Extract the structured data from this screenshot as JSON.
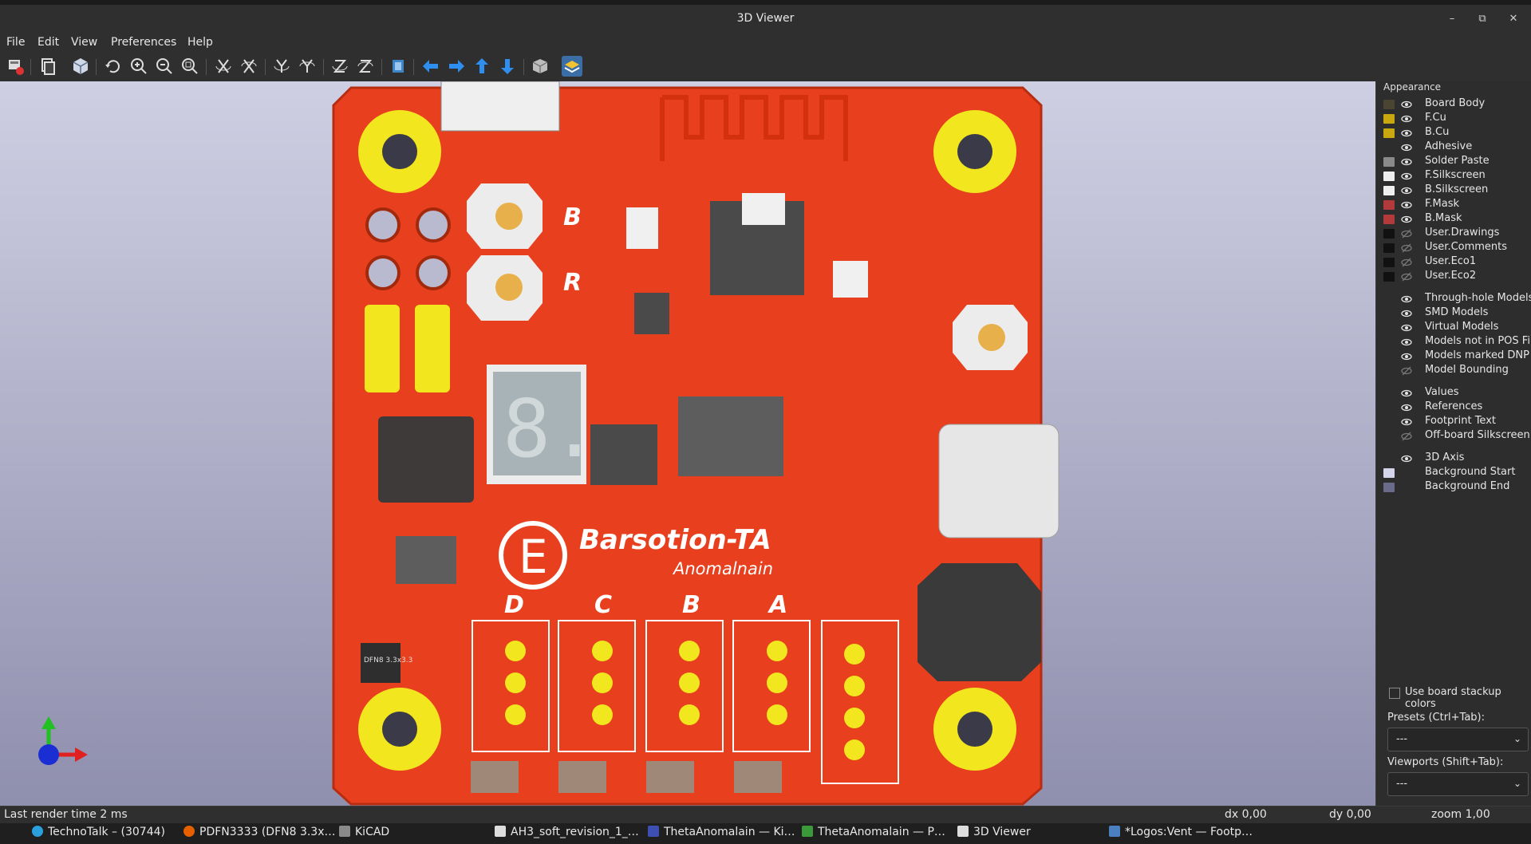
{
  "window": {
    "title": "3D Viewer"
  },
  "window_controls": {
    "minimize_glyph": "–",
    "restore_glyph": "⧉",
    "close_glyph": "✕"
  },
  "menu": {
    "items": [
      "File",
      "Edit",
      "View",
      "Preferences",
      "Help"
    ]
  },
  "toolbar": {
    "icons": [
      "export-image-icon",
      "copy-image-icon",
      "raytracing-icon",
      "reload-icon",
      "zoom-in-icon",
      "zoom-out-icon",
      "zoom-fit-icon",
      "rotate-x-cw-icon",
      "rotate-x-ccw-icon",
      "rotate-y-cw-icon",
      "rotate-y-ccw-icon",
      "rotate-z-cw-icon",
      "rotate-z-ccw-icon",
      "flip-board-icon",
      "move-left-icon",
      "move-right-icon",
      "move-up-icon",
      "move-down-icon",
      "orthographic-icon",
      "layers-manager-icon"
    ]
  },
  "board": {
    "brand_text": "Barsotion-TA",
    "sub_text": "Anomalnain",
    "logo_letter": "E",
    "button_labels": [
      "B",
      "R"
    ],
    "connector_labels": [
      "D",
      "C",
      "B",
      "A"
    ],
    "ic_marking": "DFN8 3.3x3.3",
    "digit_glyph": "8."
  },
  "appearance": {
    "title": "Appearance",
    "layers": [
      {
        "name": "Board Body",
        "color": "#4a4433",
        "visible": true
      },
      {
        "name": "F.Cu",
        "color": "#c9a70f",
        "visible": true
      },
      {
        "name": "B.Cu",
        "color": "#c9a70f",
        "visible": true
      },
      {
        "name": "Adhesive",
        "color": "",
        "visible": true
      },
      {
        "name": "Solder Paste",
        "color": "#8a8a8a",
        "visible": true
      },
      {
        "name": "F.Silkscreen",
        "color": "#eeeeee",
        "visible": true
      },
      {
        "name": "B.Silkscreen",
        "color": "#eeeeee",
        "visible": true
      },
      {
        "name": "F.Mask",
        "color": "#b33a3a",
        "visible": true
      },
      {
        "name": "B.Mask",
        "color": "#b33a3a",
        "visible": true
      },
      {
        "name": "User.Drawings",
        "color": "#111111",
        "visible": false
      },
      {
        "name": "User.Comments",
        "color": "#111111",
        "visible": false
      },
      {
        "name": "User.Eco1",
        "color": "#111111",
        "visible": false
      },
      {
        "name": "User.Eco2",
        "color": "#111111",
        "visible": false
      }
    ],
    "objects": [
      {
        "name": "Through-hole Models",
        "visible": true
      },
      {
        "name": "SMD Models",
        "visible": true
      },
      {
        "name": "Virtual Models",
        "visible": true
      },
      {
        "name": "Models not in POS File",
        "visible": true
      },
      {
        "name": "Models marked DNP",
        "visible": true
      },
      {
        "name": "Model Bounding",
        "visible": false
      }
    ],
    "text_items": [
      {
        "name": "Values",
        "visible": true
      },
      {
        "name": "References",
        "visible": true
      },
      {
        "name": "Footprint Text",
        "visible": true
      },
      {
        "name": "Off-board Silkscreen",
        "visible": false
      }
    ],
    "misc": [
      {
        "name": "3D Axis",
        "color": "",
        "visible": true
      },
      {
        "name": "Background Start",
        "color": "#d4d4ea",
        "visible": null
      },
      {
        "name": "Background End",
        "color": "#6a6a8a",
        "visible": null
      }
    ],
    "use_stackup_label": "Use board stackup colors",
    "presets_label": "Presets (Ctrl+Tab):",
    "presets_value": "---",
    "viewports_label": "Viewports (Shift+Tab):",
    "viewports_value": "---"
  },
  "status": {
    "render_time": "Last render time 2 ms",
    "dx": "dx 0,00",
    "dy": "dy 0,00",
    "zoom": "zoom 1,00"
  },
  "taskbar": {
    "items": [
      {
        "label": "TechnoTalk – (30744)",
        "color": "#2aa1de"
      },
      {
        "label": "PDFN3333 (DFN8 3.3x…",
        "color": "#e66000"
      },
      {
        "label": "KiCAD",
        "color": "#8a8a8a"
      },
      {
        "label": "AH3_soft_revision_1_…",
        "color": "#dddddd"
      },
      {
        "label": "ThetaAnomalain — Ki…",
        "color": "#3d4fb2"
      },
      {
        "label": "ThetaAnomalain — P…",
        "color": "#3a9a3a"
      },
      {
        "label": "3D Viewer",
        "color": "#dddddd"
      },
      {
        "label": "*Logos:Vent — Footp…",
        "color": "#4a7fc0"
      }
    ]
  }
}
